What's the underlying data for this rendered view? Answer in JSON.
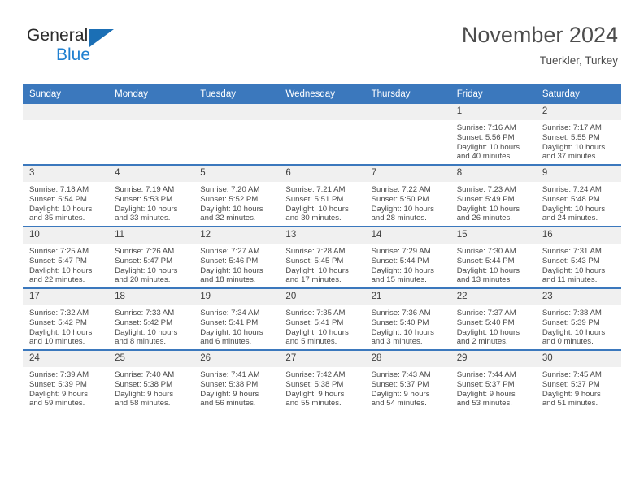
{
  "branding": {
    "word_one": "General",
    "word_two": "Blue",
    "logo_icon": "triangle-logo-icon",
    "accent_color": "#2080d0",
    "triangle_color": "#1b6fb5"
  },
  "header": {
    "title": "November 2024",
    "location": "Tuerkler, Turkey"
  },
  "theme": {
    "header_row_background": "#3b78bd",
    "daynum_background": "#f0f0f0",
    "row_divider": "#3b78bd",
    "text_color": "#4a4a4a"
  },
  "weekday_headers": [
    "Sunday",
    "Monday",
    "Tuesday",
    "Wednesday",
    "Thursday",
    "Friday",
    "Saturday"
  ],
  "weeks": [
    [
      {
        "day": "",
        "empty": true
      },
      {
        "day": "",
        "empty": true
      },
      {
        "day": "",
        "empty": true
      },
      {
        "day": "",
        "empty": true
      },
      {
        "day": "",
        "empty": true
      },
      {
        "day": "1",
        "sunrise": "Sunrise: 7:16 AM",
        "sunset": "Sunset: 5:56 PM",
        "daylight_line1": "Daylight: 10 hours",
        "daylight_line2": "and 40 minutes."
      },
      {
        "day": "2",
        "sunrise": "Sunrise: 7:17 AM",
        "sunset": "Sunset: 5:55 PM",
        "daylight_line1": "Daylight: 10 hours",
        "daylight_line2": "and 37 minutes."
      }
    ],
    [
      {
        "day": "3",
        "sunrise": "Sunrise: 7:18 AM",
        "sunset": "Sunset: 5:54 PM",
        "daylight_line1": "Daylight: 10 hours",
        "daylight_line2": "and 35 minutes."
      },
      {
        "day": "4",
        "sunrise": "Sunrise: 7:19 AM",
        "sunset": "Sunset: 5:53 PM",
        "daylight_line1": "Daylight: 10 hours",
        "daylight_line2": "and 33 minutes."
      },
      {
        "day": "5",
        "sunrise": "Sunrise: 7:20 AM",
        "sunset": "Sunset: 5:52 PM",
        "daylight_line1": "Daylight: 10 hours",
        "daylight_line2": "and 32 minutes."
      },
      {
        "day": "6",
        "sunrise": "Sunrise: 7:21 AM",
        "sunset": "Sunset: 5:51 PM",
        "daylight_line1": "Daylight: 10 hours",
        "daylight_line2": "and 30 minutes."
      },
      {
        "day": "7",
        "sunrise": "Sunrise: 7:22 AM",
        "sunset": "Sunset: 5:50 PM",
        "daylight_line1": "Daylight: 10 hours",
        "daylight_line2": "and 28 minutes."
      },
      {
        "day": "8",
        "sunrise": "Sunrise: 7:23 AM",
        "sunset": "Sunset: 5:49 PM",
        "daylight_line1": "Daylight: 10 hours",
        "daylight_line2": "and 26 minutes."
      },
      {
        "day": "9",
        "sunrise": "Sunrise: 7:24 AM",
        "sunset": "Sunset: 5:48 PM",
        "daylight_line1": "Daylight: 10 hours",
        "daylight_line2": "and 24 minutes."
      }
    ],
    [
      {
        "day": "10",
        "sunrise": "Sunrise: 7:25 AM",
        "sunset": "Sunset: 5:47 PM",
        "daylight_line1": "Daylight: 10 hours",
        "daylight_line2": "and 22 minutes."
      },
      {
        "day": "11",
        "sunrise": "Sunrise: 7:26 AM",
        "sunset": "Sunset: 5:47 PM",
        "daylight_line1": "Daylight: 10 hours",
        "daylight_line2": "and 20 minutes."
      },
      {
        "day": "12",
        "sunrise": "Sunrise: 7:27 AM",
        "sunset": "Sunset: 5:46 PM",
        "daylight_line1": "Daylight: 10 hours",
        "daylight_line2": "and 18 minutes."
      },
      {
        "day": "13",
        "sunrise": "Sunrise: 7:28 AM",
        "sunset": "Sunset: 5:45 PM",
        "daylight_line1": "Daylight: 10 hours",
        "daylight_line2": "and 17 minutes."
      },
      {
        "day": "14",
        "sunrise": "Sunrise: 7:29 AM",
        "sunset": "Sunset: 5:44 PM",
        "daylight_line1": "Daylight: 10 hours",
        "daylight_line2": "and 15 minutes."
      },
      {
        "day": "15",
        "sunrise": "Sunrise: 7:30 AM",
        "sunset": "Sunset: 5:44 PM",
        "daylight_line1": "Daylight: 10 hours",
        "daylight_line2": "and 13 minutes."
      },
      {
        "day": "16",
        "sunrise": "Sunrise: 7:31 AM",
        "sunset": "Sunset: 5:43 PM",
        "daylight_line1": "Daylight: 10 hours",
        "daylight_line2": "and 11 minutes."
      }
    ],
    [
      {
        "day": "17",
        "sunrise": "Sunrise: 7:32 AM",
        "sunset": "Sunset: 5:42 PM",
        "daylight_line1": "Daylight: 10 hours",
        "daylight_line2": "and 10 minutes."
      },
      {
        "day": "18",
        "sunrise": "Sunrise: 7:33 AM",
        "sunset": "Sunset: 5:42 PM",
        "daylight_line1": "Daylight: 10 hours",
        "daylight_line2": "and 8 minutes."
      },
      {
        "day": "19",
        "sunrise": "Sunrise: 7:34 AM",
        "sunset": "Sunset: 5:41 PM",
        "daylight_line1": "Daylight: 10 hours",
        "daylight_line2": "and 6 minutes."
      },
      {
        "day": "20",
        "sunrise": "Sunrise: 7:35 AM",
        "sunset": "Sunset: 5:41 PM",
        "daylight_line1": "Daylight: 10 hours",
        "daylight_line2": "and 5 minutes."
      },
      {
        "day": "21",
        "sunrise": "Sunrise: 7:36 AM",
        "sunset": "Sunset: 5:40 PM",
        "daylight_line1": "Daylight: 10 hours",
        "daylight_line2": "and 3 minutes."
      },
      {
        "day": "22",
        "sunrise": "Sunrise: 7:37 AM",
        "sunset": "Sunset: 5:40 PM",
        "daylight_line1": "Daylight: 10 hours",
        "daylight_line2": "and 2 minutes."
      },
      {
        "day": "23",
        "sunrise": "Sunrise: 7:38 AM",
        "sunset": "Sunset: 5:39 PM",
        "daylight_line1": "Daylight: 10 hours",
        "daylight_line2": "and 0 minutes."
      }
    ],
    [
      {
        "day": "24",
        "sunrise": "Sunrise: 7:39 AM",
        "sunset": "Sunset: 5:39 PM",
        "daylight_line1": "Daylight: 9 hours",
        "daylight_line2": "and 59 minutes."
      },
      {
        "day": "25",
        "sunrise": "Sunrise: 7:40 AM",
        "sunset": "Sunset: 5:38 PM",
        "daylight_line1": "Daylight: 9 hours",
        "daylight_line2": "and 58 minutes."
      },
      {
        "day": "26",
        "sunrise": "Sunrise: 7:41 AM",
        "sunset": "Sunset: 5:38 PM",
        "daylight_line1": "Daylight: 9 hours",
        "daylight_line2": "and 56 minutes."
      },
      {
        "day": "27",
        "sunrise": "Sunrise: 7:42 AM",
        "sunset": "Sunset: 5:38 PM",
        "daylight_line1": "Daylight: 9 hours",
        "daylight_line2": "and 55 minutes."
      },
      {
        "day": "28",
        "sunrise": "Sunrise: 7:43 AM",
        "sunset": "Sunset: 5:37 PM",
        "daylight_line1": "Daylight: 9 hours",
        "daylight_line2": "and 54 minutes."
      },
      {
        "day": "29",
        "sunrise": "Sunrise: 7:44 AM",
        "sunset": "Sunset: 5:37 PM",
        "daylight_line1": "Daylight: 9 hours",
        "daylight_line2": "and 53 minutes."
      },
      {
        "day": "30",
        "sunrise": "Sunrise: 7:45 AM",
        "sunset": "Sunset: 5:37 PM",
        "daylight_line1": "Daylight: 9 hours",
        "daylight_line2": "and 51 minutes."
      }
    ]
  ]
}
